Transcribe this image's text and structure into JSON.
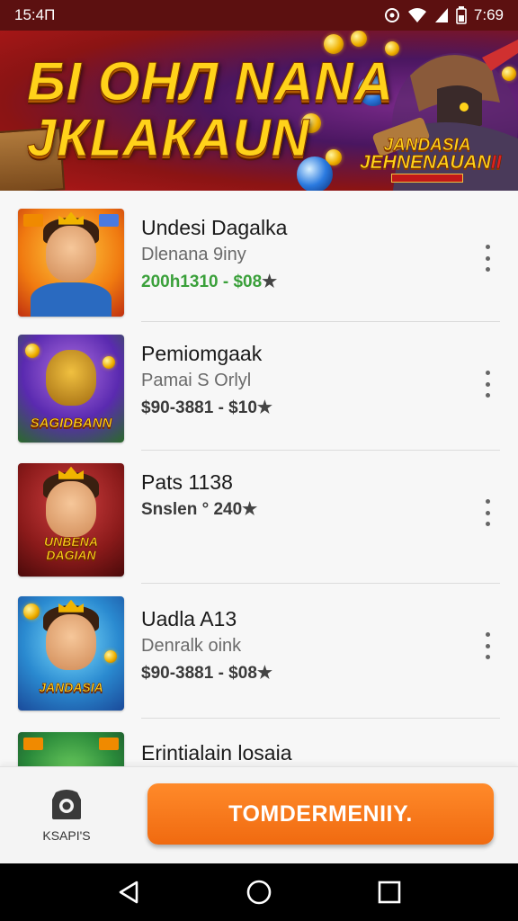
{
  "status_bar": {
    "time": "15:4П",
    "clock_right": "7:69",
    "icons": [
      "notification-icon",
      "wifi-icon",
      "signal-icon",
      "battery-icon"
    ]
  },
  "banner": {
    "line1": "БI ОНЛ NАNА",
    "line2": "JКLАКАUN",
    "logo_line1": "JANDASIA",
    "logo_line2": "JEHNENAUAN",
    "logo_suffix": "II"
  },
  "games": [
    {
      "title": "Undesi Dagalka",
      "subtitle": "Dlenana 9iny",
      "meta": "200h1310 - $08",
      "meta_color": "green",
      "thumb_tag": ""
    },
    {
      "title": "Pemiomgaak",
      "subtitle": "Pamai S Orlyl",
      "meta": "$90-3881 - $10",
      "meta_color": "dark",
      "thumb_tag": "SAGIDBANN"
    },
    {
      "title": "Pats 1138",
      "subtitle": "",
      "meta": "Snslen ° 240",
      "meta_color": "dark",
      "thumb_tag": "UNBENA DAGIAN"
    },
    {
      "title": "Uadla A13",
      "subtitle": "Denralk oink",
      "meta": "$90-3881 - $08",
      "meta_color": "dark",
      "thumb_tag": "JANDASIA"
    },
    {
      "title": "Erintialain losaia",
      "subtitle": "",
      "meta": "",
      "meta_color": "dark",
      "thumb_tag": ""
    }
  ],
  "action_bar": {
    "mini_app_label": "KSAPI'S",
    "cta_label": "TOMDERMENIIY."
  },
  "nav": [
    "back-icon",
    "home-icon",
    "recents-icon"
  ],
  "colors": {
    "status_bar": "#5c1010",
    "cta": "#f47a1a",
    "meta_green": "#3aa03a"
  }
}
